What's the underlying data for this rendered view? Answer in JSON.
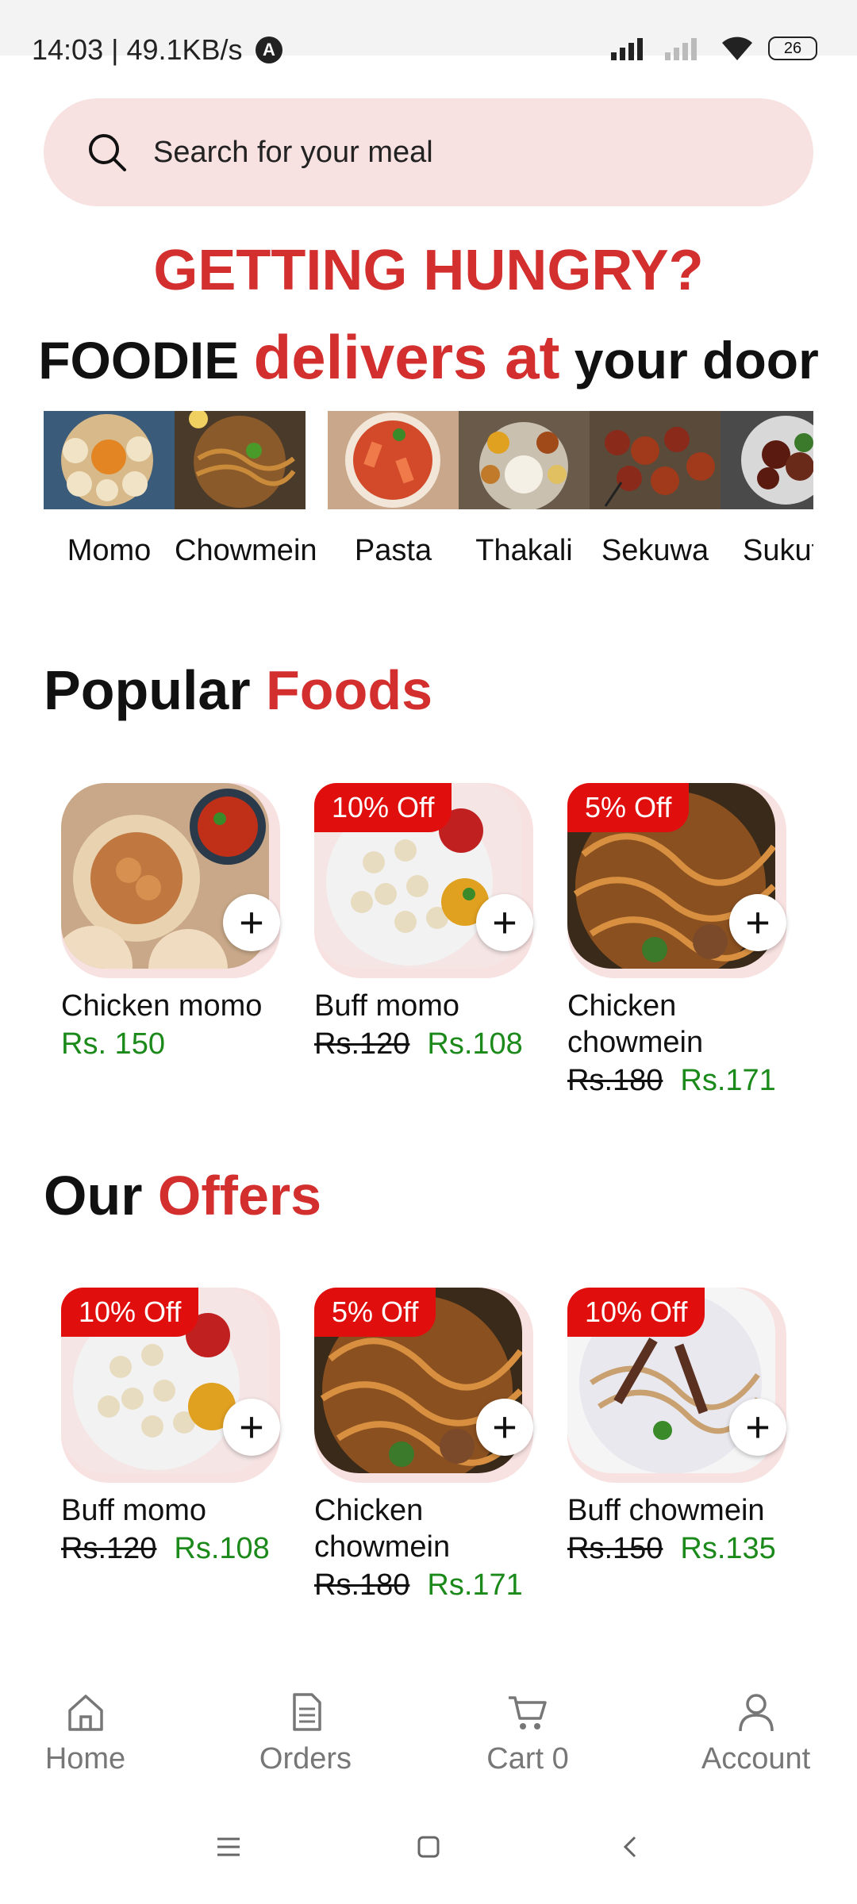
{
  "status_bar": {
    "time_speed": "14:03 | 49.1KB/s",
    "battery": "26"
  },
  "search": {
    "placeholder": "Search for your meal"
  },
  "hero": {
    "line1": "GETTING HUNGRY?",
    "line2_part1": "FOODIE ",
    "line2_part2": "delivers at",
    "line2_part3": " your door"
  },
  "categories": [
    {
      "label": "Momo",
      "icon": "momo-image"
    },
    {
      "label": "Chowmein",
      "icon": "chowmein-image"
    },
    {
      "label": "Pasta",
      "icon": "pasta-image"
    },
    {
      "label": "Thakali",
      "icon": "thakali-image"
    },
    {
      "label": "Sekuwa",
      "icon": "sekuwa-image"
    },
    {
      "label": "Sukuti",
      "icon": "sukuti-image"
    }
  ],
  "popular": {
    "title_part1": "Popular ",
    "title_part2": "Foods",
    "items": [
      {
        "name": "Chicken momo",
        "price": "Rs. 150",
        "badge": "",
        "old_price": ""
      },
      {
        "name": "Buff momo",
        "badge": "10% Off",
        "old_price": "Rs.120",
        "price": "Rs.108"
      },
      {
        "name": "Chicken chowmein",
        "badge": "5% Off",
        "old_price": "Rs.180",
        "price": "Rs.171"
      }
    ]
  },
  "offers": {
    "title_part1": "Our ",
    "title_part2": "Offers",
    "items": [
      {
        "name": "Buff momo",
        "badge": "10% Off",
        "old_price": "Rs.120",
        "price": "Rs.108"
      },
      {
        "name": "Chicken chowmein",
        "badge": "5% Off",
        "old_price": "Rs.180",
        "price": "Rs.171"
      },
      {
        "name": "Buff chowmein",
        "badge": "10% Off",
        "old_price": "Rs.150",
        "price": "Rs.135"
      }
    ]
  },
  "bottom_nav": [
    {
      "label": "Home",
      "icon": "home-icon"
    },
    {
      "label": "Orders",
      "icon": "orders-icon"
    },
    {
      "label": "Cart 0",
      "icon": "cart-icon"
    },
    {
      "label": "Account",
      "icon": "account-icon"
    }
  ],
  "colors": {
    "accent": "#d32f2f",
    "price_green": "#1b8a1b",
    "badge_red": "#e10e0e",
    "card_bg": "#f8e1e1"
  }
}
